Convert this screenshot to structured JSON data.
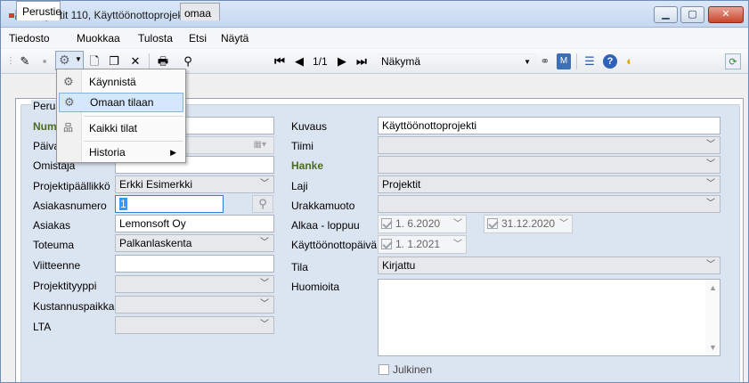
{
  "window": {
    "title": "Projektit 110, Käyttöönottoprojekti",
    "minimize": "▁",
    "maximize": "▢",
    "close": "✕"
  },
  "menu": [
    "Tiedosto",
    "Muokkaa",
    "Tulosta",
    "Etsi",
    "Näytä"
  ],
  "toolbar": {
    "pager": "1/1",
    "view_label": "Näkymä"
  },
  "tabs": [
    "Perustiedot",
    "Omaa"
  ],
  "tabs_visible": [
    "Perustie",
    "omaa"
  ],
  "group_title": "Perustiedot",
  "group_title_visible": "Perust",
  "dropdown": {
    "items": [
      "Käynnistä",
      "Omaan tilaan",
      "Kaikki tilat",
      "Historia"
    ]
  },
  "left": {
    "number_label": "Numero",
    "number_label_visible": "Num",
    "date_label": "Päivä",
    "date_label_visible": "Päiva",
    "owner_label": "Omistaja",
    "owner_label_visible": "Omistaja",
    "pm_label": "Projektipäällikkö",
    "pm_value": "Erkki Esimerkki",
    "customer_no_label": "Asiakasnumero",
    "customer_no_value": "1",
    "customer_label": "Asiakas",
    "customer_value": "Lemonsoft Oy",
    "realization_label": "Toteuma",
    "realization_value": "Palkanlaskenta",
    "reference_label": "Viitteenne",
    "project_type_label": "Projektityyppi",
    "cost_center_label": "Kustannuspaikka",
    "lta_label": "LTA"
  },
  "right": {
    "description_label": "Kuvaus",
    "description_value": "Käyttöönottoprojekti",
    "team_label": "Tiimi",
    "venture_label": "Hanke",
    "type_label": "Laji",
    "type_value": "Projektit",
    "contract_label": "Urakkamuoto",
    "period_label": "Alkaa - loppuu",
    "start_value": "1.  6.2020",
    "end_value": "31.12.2020",
    "deploy_label": "Käyttöönottopäivä",
    "deploy_value": "1.  1.2021",
    "state_label": "Tila",
    "state_value": "Kirjattu",
    "notes_label": "Huomioita",
    "public_label": "Julkinen"
  }
}
